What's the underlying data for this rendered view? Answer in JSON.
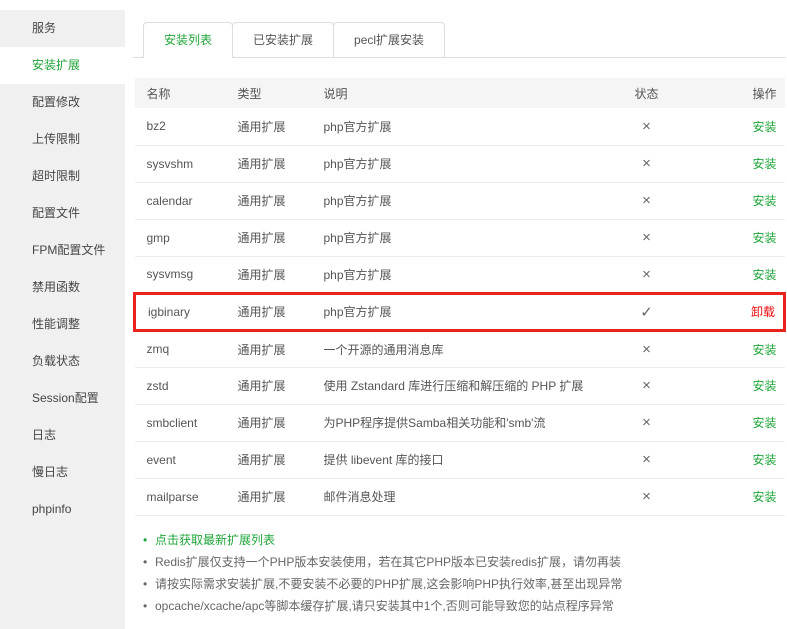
{
  "sidebar": {
    "items": [
      {
        "label": "服务",
        "active": false
      },
      {
        "label": "安装扩展",
        "active": true
      },
      {
        "label": "配置修改",
        "active": false
      },
      {
        "label": "上传限制",
        "active": false
      },
      {
        "label": "超时限制",
        "active": false
      },
      {
        "label": "配置文件",
        "active": false
      },
      {
        "label": "FPM配置文件",
        "active": false
      },
      {
        "label": "禁用函数",
        "active": false
      },
      {
        "label": "性能调整",
        "active": false
      },
      {
        "label": "负载状态",
        "active": false
      },
      {
        "label": "Session配置",
        "active": false
      },
      {
        "label": "日志",
        "active": false
      },
      {
        "label": "慢日志",
        "active": false
      },
      {
        "label": "phpinfo",
        "active": false
      }
    ]
  },
  "tabs": [
    {
      "label": "安装列表",
      "active": true
    },
    {
      "label": "已安装扩展",
      "active": false
    },
    {
      "label": "pecl扩展安装",
      "active": false
    }
  ],
  "table": {
    "headers": [
      "名称",
      "类型",
      "说明",
      "状态",
      "操作"
    ],
    "icons": {
      "installed": "✓",
      "not_installed": "×"
    },
    "rows": [
      {
        "name": "bz2",
        "type": "通用扩展",
        "desc": "php官方扩展",
        "installed": false,
        "action": "安装",
        "highlighted": false
      },
      {
        "name": "sysvshm",
        "type": "通用扩展",
        "desc": "php官方扩展",
        "installed": false,
        "action": "安装",
        "highlighted": false
      },
      {
        "name": "calendar",
        "type": "通用扩展",
        "desc": "php官方扩展",
        "installed": false,
        "action": "安装",
        "highlighted": false
      },
      {
        "name": "gmp",
        "type": "通用扩展",
        "desc": "php官方扩展",
        "installed": false,
        "action": "安装",
        "highlighted": false
      },
      {
        "name": "sysvmsg",
        "type": "通用扩展",
        "desc": "php官方扩展",
        "installed": false,
        "action": "安装",
        "highlighted": false
      },
      {
        "name": "igbinary",
        "type": "通用扩展",
        "desc": "php官方扩展",
        "installed": true,
        "action": "卸载",
        "highlighted": true
      },
      {
        "name": "zmq",
        "type": "通用扩展",
        "desc": "一个开源的通用消息库",
        "installed": false,
        "action": "安装",
        "highlighted": false
      },
      {
        "name": "zstd",
        "type": "通用扩展",
        "desc": "使用 Zstandard 库进行压缩和解压缩的 PHP 扩展",
        "installed": false,
        "action": "安装",
        "highlighted": false
      },
      {
        "name": "smbclient",
        "type": "通用扩展",
        "desc": "为PHP程序提供Samba相关功能和'smb'流",
        "installed": false,
        "action": "安装",
        "highlighted": false
      },
      {
        "name": "event",
        "type": "通用扩展",
        "desc": "提供 libevent 库的接口",
        "installed": false,
        "action": "安装",
        "highlighted": false
      },
      {
        "name": "mailparse",
        "type": "通用扩展",
        "desc": "邮件消息处理",
        "installed": false,
        "action": "安装",
        "highlighted": false
      }
    ]
  },
  "notes": {
    "items": [
      {
        "text": "点击获取最新扩展列表",
        "is_link": true
      },
      {
        "text": "Redis扩展仅支持一个PHP版本安装使用，若在其它PHP版本已安装redis扩展，请勿再装",
        "is_link": false
      },
      {
        "text": "请按实际需求安装扩展,不要安装不必要的PHP扩展,这会影响PHP执行效率,甚至出现异常",
        "is_link": false
      },
      {
        "text": "opcache/xcache/apc等脚本缓存扩展,请只安装其中1个,否则可能导致您的站点程序异常",
        "is_link": false
      }
    ]
  },
  "colors": {
    "accent": "#20a53a",
    "danger": "#ef0808",
    "highlight_border": "#e8231d"
  }
}
